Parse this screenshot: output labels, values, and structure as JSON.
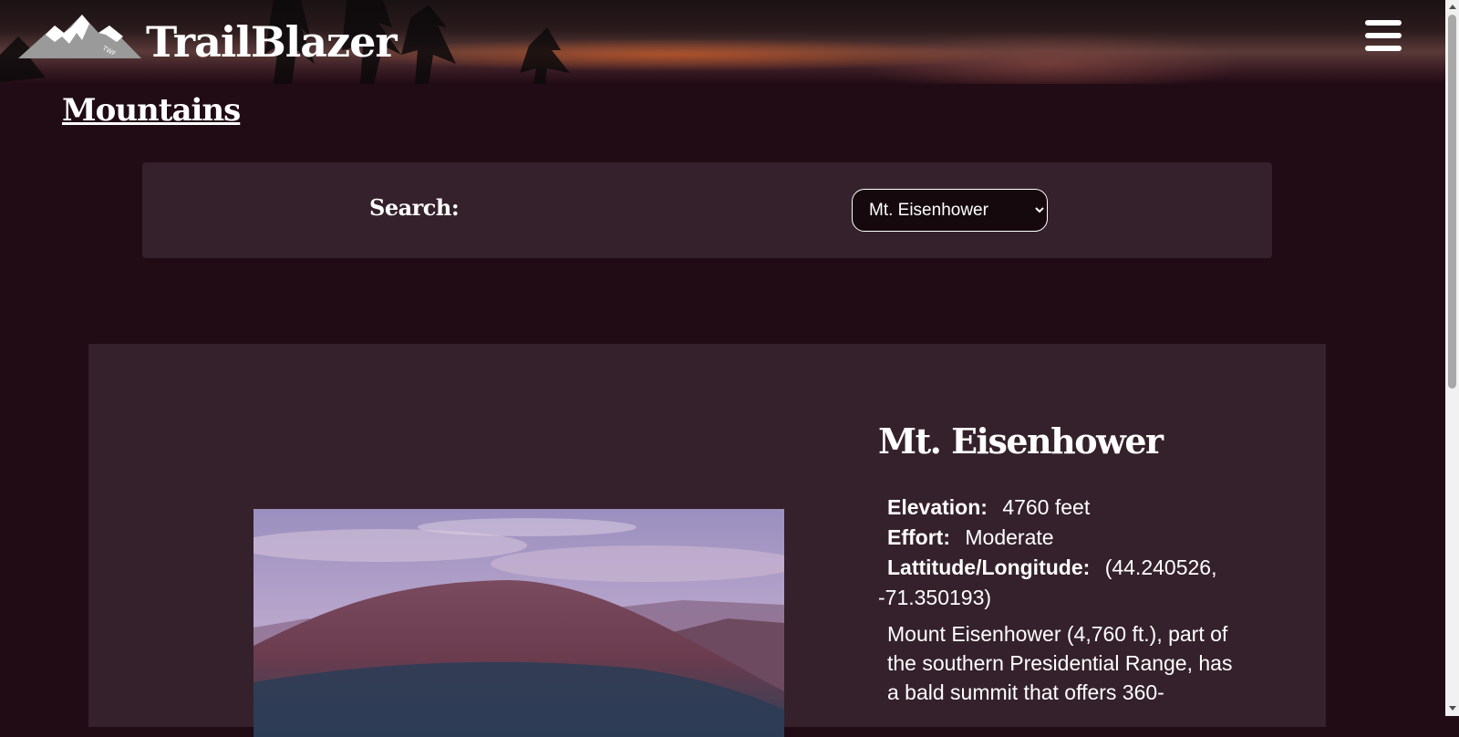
{
  "header": {
    "brand": "TrailBlazer",
    "logo_icon": "mountain-logo-icon",
    "menu_icon": "hamburger-menu-icon"
  },
  "page": {
    "title": "Mountains"
  },
  "search": {
    "label": "Search:",
    "selected": "Mt. Eisenhower"
  },
  "mountain": {
    "name": "Mt. Eisenhower",
    "elevation_label": "Elevation:",
    "elevation_value": "4760 feet",
    "effort_label": "Effort:",
    "effort_value": "Moderate",
    "latlon_label": "Lattitude/Longitude:",
    "latlon_value_1": "(44.240526,",
    "latlon_value_2": "-71.350193)",
    "description": "Mount Eisenhower (4,760 ft.), part of the southern Presidential Range, has a bald summit that offers 360-"
  },
  "colors": {
    "page_bg": "#210b15",
    "panel_bg": "#35212b",
    "text": "#ffffff"
  }
}
